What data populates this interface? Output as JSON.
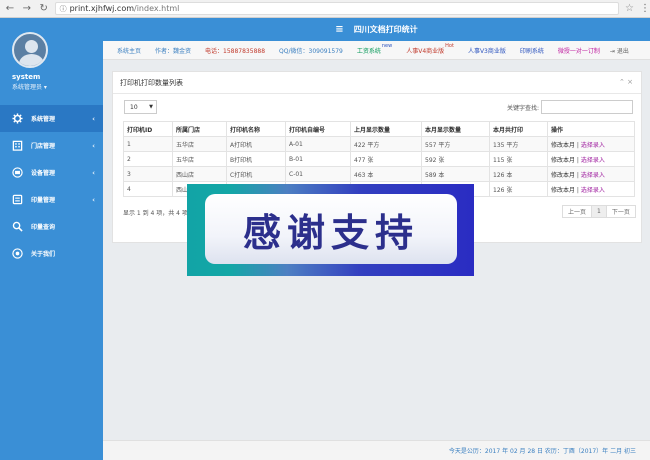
{
  "browser": {
    "url_host": "print.xjhfwj.com",
    "url_path": "/index.html"
  },
  "user": {
    "name": "system",
    "role": "系统管理员 ▾"
  },
  "sidebar": {
    "items": [
      {
        "label": "系统管理",
        "icon": "gear-icon",
        "active": true
      },
      {
        "label": "门店管理",
        "icon": "building-icon"
      },
      {
        "label": "设备管理",
        "icon": "device-icon"
      },
      {
        "label": "印量管理",
        "icon": "ledger-icon"
      },
      {
        "label": "印量查询",
        "icon": "search-icon"
      },
      {
        "label": "关于我们",
        "icon": "info-icon"
      }
    ]
  },
  "header": {
    "title": "四川文档打印统计"
  },
  "nav": {
    "tabs": [
      {
        "label": "系统主页",
        "color": "#3a7fc0"
      },
      {
        "label": "作者：魏金资",
        "color": "#3a7fc0"
      },
      {
        "label": "电话：15887835888",
        "color": "#c0392b"
      },
      {
        "label": "QQ/微信：309091579",
        "color": "#3a7fc0"
      },
      {
        "label": "工资系统",
        "sup": "new",
        "color": "#0a9a5a"
      },
      {
        "label": "人事V4商业版",
        "sup": "Hot",
        "color": "#c0392b"
      },
      {
        "label": "人事V3商业版",
        "color": "#2a52be"
      },
      {
        "label": "印刷系统",
        "color": "#2a52be"
      },
      {
        "label": "微授一对一订制",
        "color": "#c020a0"
      },
      {
        "label": "⇥ 退出",
        "color": "#666"
      }
    ]
  },
  "panel": {
    "title": "打印机打印数量列表",
    "tools": "⌃ ×",
    "page_size": "10",
    "search_label": "关键字查找:",
    "columns": [
      "打印机ID",
      "所属门店",
      "打印机名称",
      "打印机自编号",
      "上月显示数量",
      "本月显示数量",
      "本月共打印",
      "操作"
    ],
    "rows": [
      {
        "id": "1",
        "store": "五华店",
        "name": "A打印机",
        "code": "A-01",
        "last": "422 平方",
        "curr": "557 平方",
        "total": "135 平方",
        "edit": "修改本月",
        "sep": " | ",
        "pick": "选择录入"
      },
      {
        "id": "2",
        "store": "五华店",
        "name": "B打印机",
        "code": "B-01",
        "last": "477 张",
        "curr": "592 张",
        "total": "115 张",
        "edit": "修改本月",
        "sep": " | ",
        "pick": "选择录入"
      },
      {
        "id": "3",
        "store": "西山店",
        "name": "C打印机",
        "code": "C-01",
        "last": "463 本",
        "curr": "589 本",
        "total": "126 本",
        "edit": "修改本月",
        "sep": " | ",
        "pick": "选择录入"
      },
      {
        "id": "4",
        "store": "西山",
        "name": "",
        "code": "",
        "last": "",
        "curr": "",
        "total": "126 张",
        "edit": "修改本月",
        "sep": " | ",
        "pick": "选择录入"
      }
    ],
    "info": "显示 1 到 4 项，共 4 项",
    "pager": {
      "prev": "上一页",
      "current": "1",
      "next": "下一页"
    }
  },
  "overlay": {
    "text": "感谢支持"
  },
  "footer": {
    "text": "今天是公历：2017 年 02 月 28 日    农历：丁酉（2017）年    二月 初三"
  }
}
